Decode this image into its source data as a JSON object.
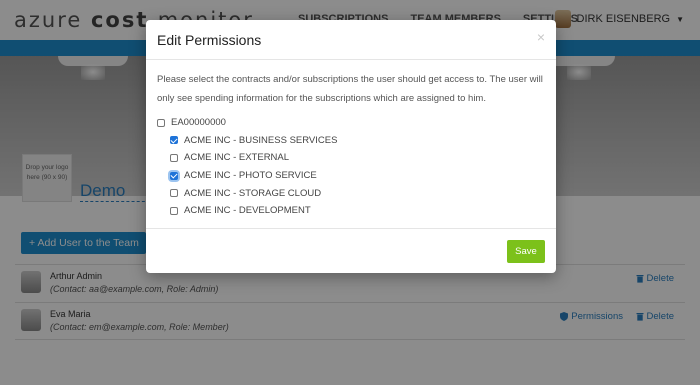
{
  "app": {
    "brand_light": "azure ",
    "brand_bold": "cost ",
    "brand_tail": "monitor",
    "nav": [
      "SUBSCRIPTIONS",
      "TEAM MEMBERS",
      "SETTINGS"
    ],
    "user_name": "DIRK EISENBERG"
  },
  "page": {
    "logo_drop_text": "Drop your logo here (90 x 90)",
    "title": "Demo Mobile Team",
    "add_user_label": "+ Add User to the Team",
    "users": [
      {
        "name": "Arthur Admin",
        "contact": "(Contact: aa@example.com, Role: Admin)",
        "show_permissions": false
      },
      {
        "name": "Eva Maria",
        "contact": "(Contact: em@example.com, Role: Member)",
        "show_permissions": true
      }
    ],
    "permissions_label": "Permissions",
    "delete_label": "Delete"
  },
  "modal": {
    "title": "Edit Permissions",
    "close_glyph": "×",
    "description": "Please select the contracts and/or subscriptions the user should get access to. The user will only see spending information for the subscriptions which are assigned to him.",
    "items": [
      {
        "label": "EA00000000",
        "checked": false,
        "level": 0
      },
      {
        "label": "ACME INC - BUSINESS SERVICES",
        "checked": true,
        "level": 1
      },
      {
        "label": "ACME INC - EXTERNAL",
        "checked": false,
        "level": 1
      },
      {
        "label": "ACME INC - PHOTO SERVICE",
        "checked": true,
        "level": 1,
        "focused": true
      },
      {
        "label": "ACME INC - STORAGE CLOUD",
        "checked": false,
        "level": 1
      },
      {
        "label": "ACME INC - DEVELOPMENT",
        "checked": false,
        "level": 1
      }
    ],
    "save_label": "Save"
  },
  "colors": {
    "accent_blue": "#1e8fd0",
    "save_green": "#7cc11a",
    "checkbox_blue": "#1e73d8",
    "overlay": "rgba(0,0,0,0.45)"
  }
}
